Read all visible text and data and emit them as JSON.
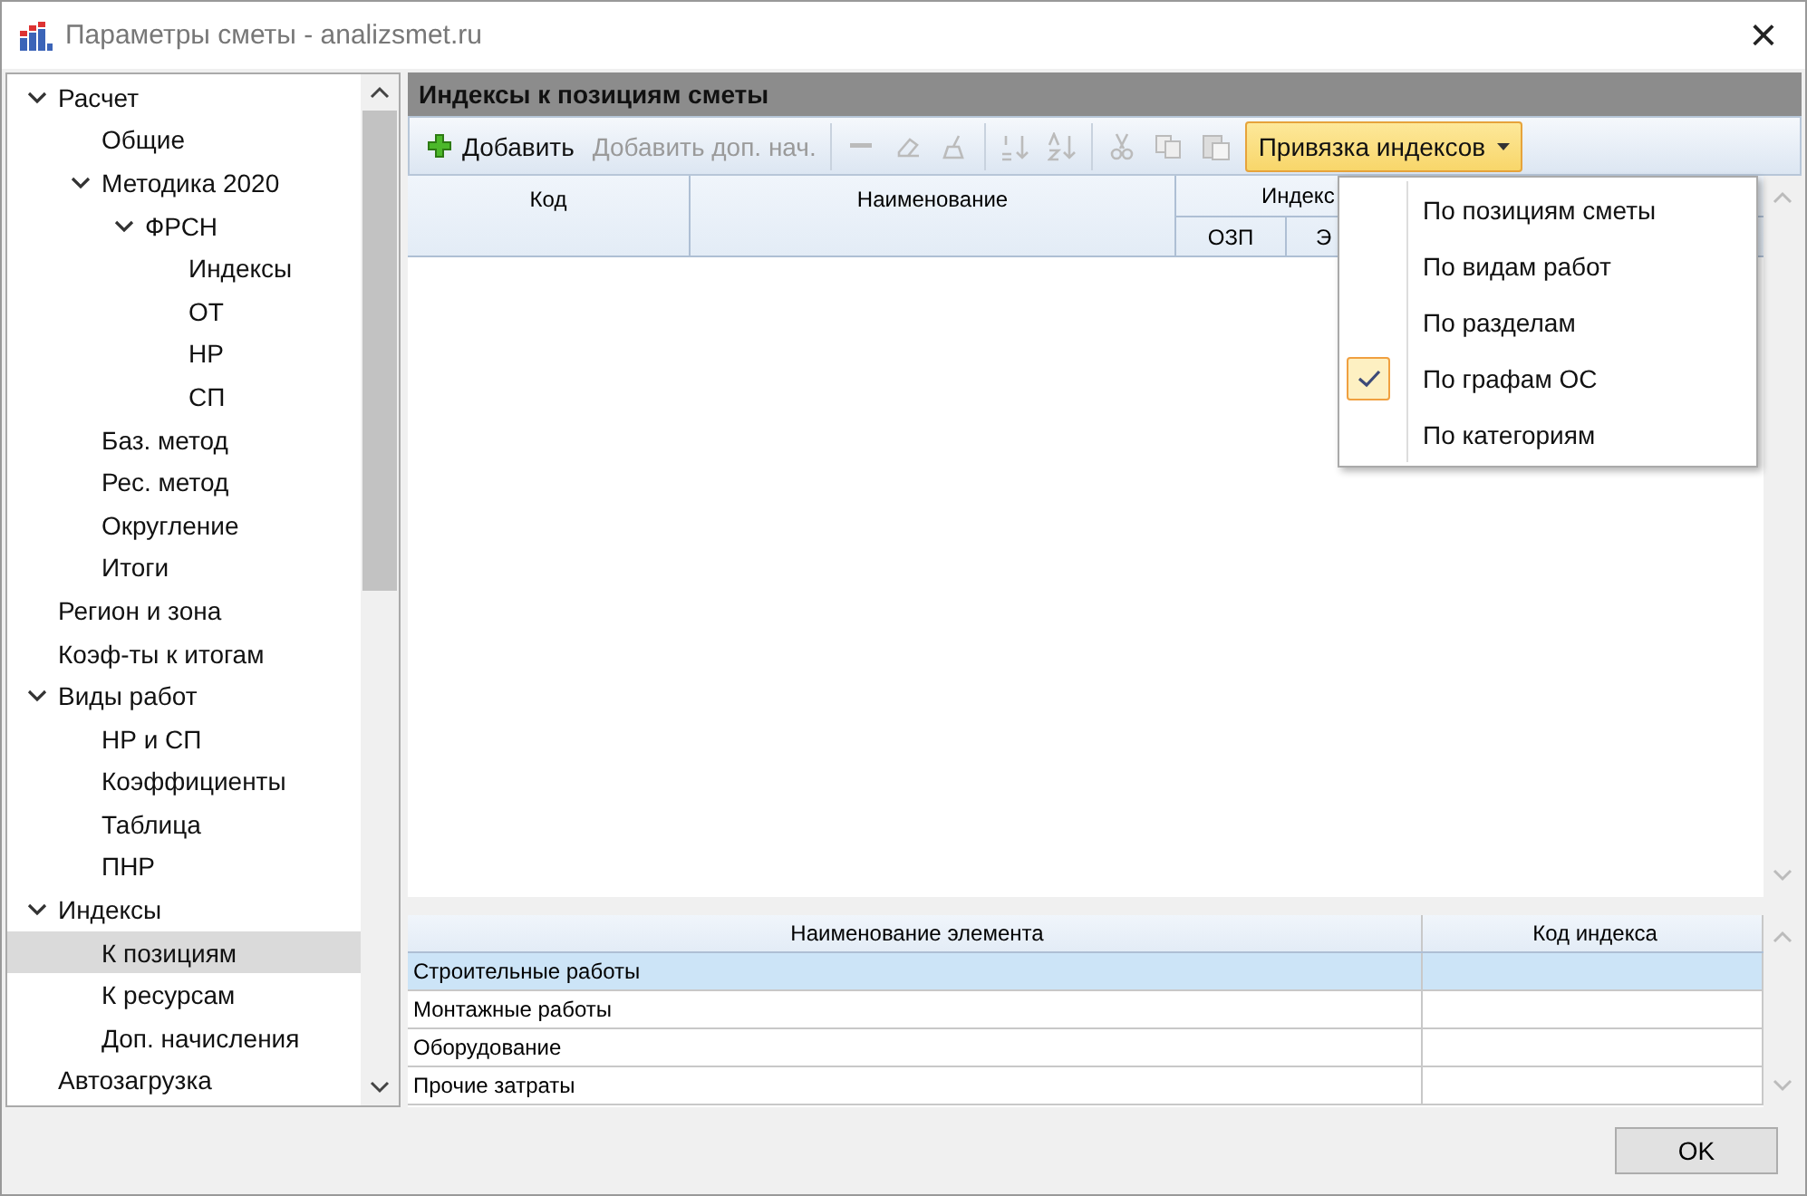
{
  "window": {
    "title": "Параметры сметы - analizsmet.ru",
    "close": "×"
  },
  "tree": [
    {
      "label": "Расчет",
      "expanded": true,
      "selected": false,
      "children": [
        {
          "label": "Общие",
          "selected": false
        },
        {
          "label": "Методика 2020",
          "expanded": true,
          "selected": false,
          "children": [
            {
              "label": "ФРСН",
              "expanded": true,
              "selected": false,
              "children": [
                {
                  "label": "Индексы",
                  "selected": false
                },
                {
                  "label": "ОТ",
                  "selected": false
                },
                {
                  "label": "НР",
                  "selected": false
                },
                {
                  "label": "СП",
                  "selected": false
                }
              ]
            }
          ]
        },
        {
          "label": "Баз. метод",
          "selected": false
        },
        {
          "label": "Рес. метод",
          "selected": false
        },
        {
          "label": "Округление",
          "selected": false
        },
        {
          "label": "Итоги",
          "selected": false
        }
      ]
    },
    {
      "label": "Регион и зона",
      "selected": false
    },
    {
      "label": "Коэф-ты к итогам",
      "selected": false
    },
    {
      "label": "Виды работ",
      "expanded": true,
      "selected": false,
      "children": [
        {
          "label": "НР и СП",
          "selected": false
        },
        {
          "label": "Коэффициенты",
          "selected": false
        },
        {
          "label": "Таблица",
          "selected": false
        },
        {
          "label": "ПНР",
          "selected": false
        }
      ]
    },
    {
      "label": "Индексы",
      "expanded": true,
      "selected": false,
      "children": [
        {
          "label": "К позициям",
          "selected": true
        },
        {
          "label": "К ресурсам",
          "selected": false
        },
        {
          "label": "Доп. начисления",
          "selected": false
        }
      ]
    },
    {
      "label": "Автозагрузка",
      "selected": false
    }
  ],
  "panel": {
    "title": "Индексы к позициям сметы"
  },
  "toolbar": [
    {
      "kind": "add",
      "label": "Добавить",
      "disabled": false
    },
    {
      "kind": "text",
      "label": "Добавить доп. нач.",
      "disabled": true
    },
    {
      "kind": "separator"
    },
    {
      "kind": "minus",
      "disabled": true
    },
    {
      "kind": "eraser",
      "disabled": true
    },
    {
      "kind": "broom",
      "disabled": true
    },
    {
      "kind": "separator"
    },
    {
      "kind": "sort-num",
      "disabled": true
    },
    {
      "kind": "sort-alpha",
      "disabled": true
    },
    {
      "kind": "separator"
    },
    {
      "kind": "cut",
      "disabled": true
    },
    {
      "kind": "copy",
      "disabled": true
    },
    {
      "kind": "paste",
      "disabled": true
    },
    {
      "kind": "dropdown",
      "label": "Привязка индексов",
      "open": true
    }
  ],
  "grid": {
    "columns": [
      "Код",
      "Наименование"
    ],
    "group": "Индекс",
    "subcolumns": [
      "ОЗП",
      "Э"
    ]
  },
  "menu": [
    {
      "label": "По позициям сметы",
      "checked": false
    },
    {
      "label": "По видам работ",
      "checked": false
    },
    {
      "label": "По разделам",
      "checked": false
    },
    {
      "label": "По графам ОС",
      "checked": true
    },
    {
      "label": "По категориям",
      "checked": false
    }
  ],
  "elements": {
    "columns": [
      "Наименование элемента",
      "Код индекса"
    ],
    "rows": [
      {
        "name": "Строительные работы",
        "selected": true
      },
      {
        "name": "Монтажные работы",
        "selected": false
      },
      {
        "name": "Оборудование",
        "selected": false
      },
      {
        "name": "Прочие затраты",
        "selected": false
      }
    ]
  },
  "buttons": [
    "OK"
  ]
}
